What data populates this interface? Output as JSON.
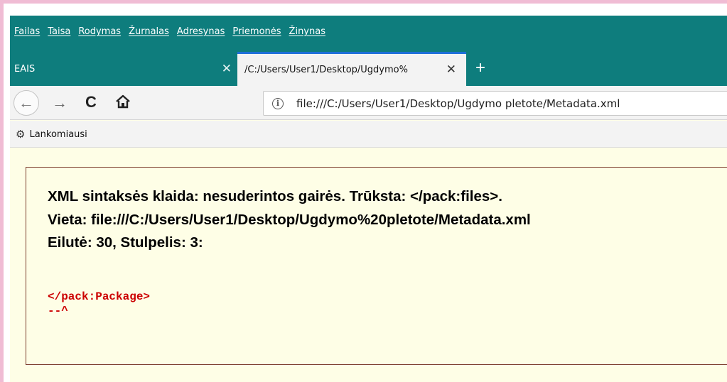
{
  "menu": [
    "Failas",
    "Taisa",
    "Rodymas",
    "Žurnalas",
    "Adresynas",
    "Priemonės",
    "Žinynas"
  ],
  "tabs": {
    "inactive_title": "EAIS",
    "active_title": "/C:/Users/User1/Desktop/Ugdymo%",
    "close_glyph": "✕",
    "new_tab_glyph": "+"
  },
  "nav": {
    "back_glyph": "←",
    "forward_glyph": "→",
    "reload_glyph": "C",
    "info_glyph": "i",
    "url": "file:///C:/Users/User1/Desktop/Ugdymo pletote/Metadata.xml"
  },
  "bookmarks": {
    "icon_glyph": "⚙",
    "label": "Lankomiausi"
  },
  "error": {
    "message": "XML sintaksės klaida: nesuderintos gairės. Trūksta: </pack:files>.",
    "location": "Vieta: file:///C:/Users/User1/Desktop/Ugdymo%20pletote/Metadata.xml",
    "position": "Eilutė: 30, Stulpelis: 3:",
    "source_line": "</pack:Package>",
    "caret_line": "--^"
  },
  "colors": {
    "toolbar_teal": "#0e7d7d",
    "active_tab_accent": "#1e6fd9",
    "page_background": "#fefee6",
    "source_red": "#cc0000",
    "frame_pink": "#f0bcd4"
  }
}
